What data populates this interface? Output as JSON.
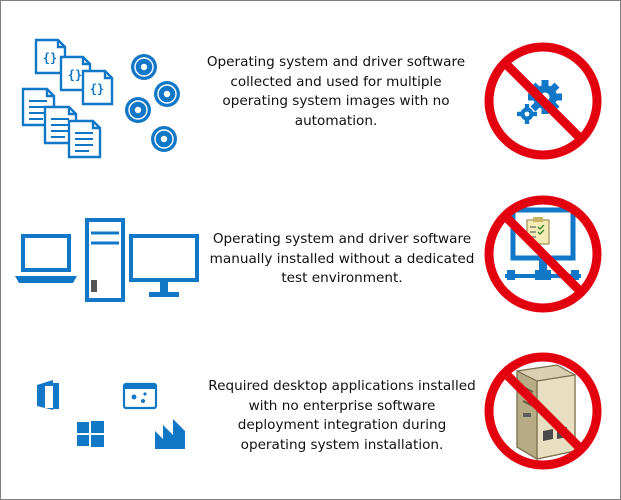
{
  "colors": {
    "icon_blue": "#1177c7",
    "prohibit_red": "#e3000f",
    "text": "#111111",
    "frame": "#7f7f7f"
  },
  "rows": [
    {
      "caption": "Operating system and driver software collected and used for multiple operating system images with no automation.",
      "caption_lines": [
        "Operating system and driver software",
        "collected and used for multiple",
        "operating system images with no",
        "automation."
      ],
      "left_icons": [
        "code-file-icon",
        "document-icon",
        "disc-icon"
      ],
      "right_icon": "gears-icon",
      "code_glyph": "{}"
    },
    {
      "caption": "Operating system and driver software manually installed without a dedicated test environment.",
      "caption_lines": [
        "Operating system and driver software",
        "manually installed without a dedicated",
        "test environment."
      ],
      "left_icons": [
        "laptop-icon",
        "tower-pc-icon",
        "monitor-icon"
      ],
      "right_icon": "network-checklist-icon"
    },
    {
      "caption": "Required desktop applications installed with no enterprise software deployment integration during operating system installation.",
      "caption_lines": [
        "Required desktop applications installed",
        "with no enterprise software",
        "deployment integration during",
        "operating system installation."
      ],
      "left_icons": [
        "office-icon",
        "app-window-icon",
        "windows-icon",
        "visual-studio-icon"
      ],
      "right_icon": "server-icon"
    }
  ]
}
